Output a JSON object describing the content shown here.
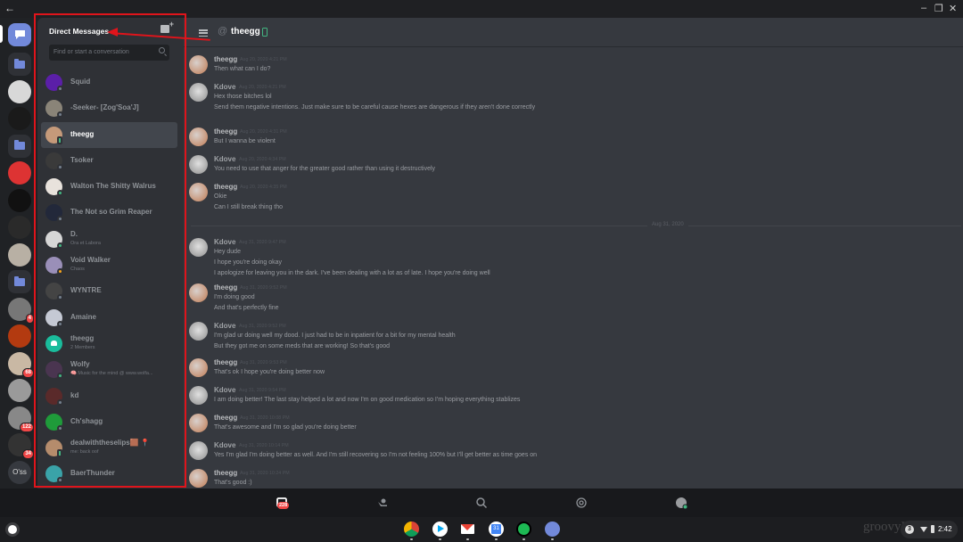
{
  "window": {
    "back_glyph": "←",
    "controls": [
      "–",
      "❐",
      "✕"
    ]
  },
  "rail": {
    "home_icon": "chat-bubble-icon",
    "servers": [
      {
        "kind": "folder"
      },
      {
        "kind": "server",
        "color": "#d8d8d8"
      },
      {
        "kind": "server",
        "color": "#1a1a1a"
      },
      {
        "kind": "folder"
      },
      {
        "kind": "server",
        "color": "#d33"
      },
      {
        "kind": "server",
        "color": "#111"
      },
      {
        "kind": "server",
        "color": "#2a2a2a"
      },
      {
        "kind": "server",
        "color": "#b8b0a4"
      },
      {
        "kind": "folder"
      },
      {
        "kind": "server",
        "color": "#777",
        "badge": "4"
      },
      {
        "kind": "server",
        "color": "#b33a10"
      },
      {
        "kind": "server",
        "color": "#c9b8a4",
        "badge": "68"
      },
      {
        "kind": "server",
        "color": "#9a9a9a"
      },
      {
        "kind": "server",
        "color": "#888",
        "badge": "122"
      },
      {
        "kind": "server",
        "color": "#333",
        "badge": "34"
      },
      {
        "kind": "text",
        "label": "O'ss"
      }
    ]
  },
  "dm": {
    "title": "Direct Messages",
    "search_placeholder": "Find or start a conversation",
    "items": [
      {
        "name": "Squid",
        "sub": "",
        "avatar": "#5b1fa8",
        "status": "offline"
      },
      {
        "name": "-Seeker- [Zog'Soa'J]",
        "sub": "",
        "avatar": "#8a8478",
        "status": "offline"
      },
      {
        "name": "theegg",
        "sub": "",
        "avatar": "#c59a7a",
        "status": "mobile",
        "active": true
      },
      {
        "name": "Tsoker",
        "sub": "",
        "avatar": "#3a3a3a",
        "status": "offline"
      },
      {
        "name": "Walton The Shitty Walrus",
        "sub": "",
        "avatar": "#e8e2dc",
        "status": "online"
      },
      {
        "name": "The Not so Grim Reaper",
        "sub": "",
        "avatar": "#22283a",
        "status": "offline"
      },
      {
        "name": "D.",
        "sub": "Ora et Labora",
        "avatar": "#d6d6d6",
        "status": "online"
      },
      {
        "name": "Void Walker",
        "sub": "Chaos",
        "avatar": "#9a8fb8",
        "status": "idle"
      },
      {
        "name": "WYNTRE",
        "sub": "",
        "avatar": "#444",
        "status": "offline"
      },
      {
        "name": "Amaine",
        "sub": "",
        "avatar": "#c5c9d4",
        "status": "offline"
      },
      {
        "name": "theegg",
        "sub": "2 Members",
        "avatar": "#1abc9c",
        "status": "group"
      },
      {
        "name": "Wolfy",
        "sub": "🧠 Music for the mind @ www.wolfa...",
        "avatar": "#4a3550",
        "status": "online"
      },
      {
        "name": "kd",
        "sub": "",
        "avatar": "#5a2a2a",
        "status": "offline"
      },
      {
        "name": "Ch'shagg",
        "sub": "",
        "avatar": "#1f9b3a",
        "status": "offline"
      },
      {
        "name": "dealwiththeselips🟫 📍",
        "sub": "me: back oof",
        "avatar": "#b58c6c",
        "status": "mobile"
      },
      {
        "name": "BaerThunder",
        "sub": "",
        "avatar": "#3aa3a8",
        "status": "offline"
      }
    ]
  },
  "chat": {
    "channel": "theegg",
    "at_symbol": "@",
    "divider_label": "Aug 31, 2020",
    "messages": [
      {
        "author": "theegg",
        "time": "Aug 20, 2020 4:21 PM",
        "lines": [
          "Then what can I do?"
        ]
      },
      {
        "author": "Kdove",
        "time": "Aug 20, 2020 4:21 PM",
        "lines": [
          "Hex those bitches lol",
          "Send them negative intentions. Just make sure to be careful cause hexes are dangerous if they aren't done correctly"
        ]
      },
      {
        "author": "theegg",
        "time": "Aug 20, 2020 4:31 PM",
        "lines": [
          "But I wanna be violent"
        ]
      },
      {
        "author": "Kdove",
        "time": "Aug 20, 2020 4:34 PM",
        "lines": [
          "You need to use that anger for the greater good rather than using it destructively"
        ]
      },
      {
        "author": "theegg",
        "time": "Aug 20, 2020 4:35 PM",
        "lines": [
          "Okie",
          "Can I still break thing tho"
        ]
      },
      {
        "author": "Kdove",
        "time": "Aug 31, 2020 9:47 PM",
        "lines": [
          "Hey dude",
          "I hope you're doing okay",
          "I apologize for leaving you in the dark. I've been dealing with a lot as of late. I hope you're doing well"
        ]
      },
      {
        "author": "theegg",
        "time": "Aug 31, 2020 9:52 PM",
        "lines": [
          "I'm doing good",
          "And that's perfectly fine"
        ]
      },
      {
        "author": "Kdove",
        "time": "Aug 31, 2020 9:52 PM",
        "lines": [
          "I'm glad ur doing well my dood. I just had to be in inpatient for a bit for my mental health",
          "But they got me on some meds that are working! So that's good"
        ]
      },
      {
        "author": "theegg",
        "time": "Aug 31, 2020 9:53 PM",
        "lines": [
          "That's ok I hope you're doing better now"
        ]
      },
      {
        "author": "Kdove",
        "time": "Aug 31, 2020 9:54 PM",
        "lines": [
          "I am doing better! The last stay helped a lot and now I'm on good medication so I'm hoping everything stablizes"
        ]
      },
      {
        "author": "theegg",
        "time": "Aug 31, 2020 10:08 PM",
        "lines": [
          "That's awesome and I'm so glad you're doing better"
        ]
      },
      {
        "author": "Kdove",
        "time": "Aug 31, 2020 10:14 PM",
        "lines": [
          "Yes I'm glad I'm doing better as well. And I'm still recovering so I'm not feeling 100% but I'll get better as time goes on"
        ]
      },
      {
        "author": "theegg",
        "time": "Aug 31, 2020 10:24 PM",
        "lines": [
          "That's good :)"
        ]
      }
    ]
  },
  "bottom_nav": {
    "items": [
      "home-icon",
      "friends-icon",
      "search-icon",
      "mentions-icon",
      "profile-icon"
    ],
    "home_badge": "228"
  },
  "shelf": {
    "apps": [
      {
        "name": "chrome",
        "color": "#db4437"
      },
      {
        "name": "play-store",
        "color": "#ffffff"
      },
      {
        "name": "gmail",
        "color": "#ea4335"
      },
      {
        "name": "calendar",
        "color": "#4285f4",
        "label": "31"
      },
      {
        "name": "spotify",
        "color": "#1db954"
      },
      {
        "name": "discord",
        "color": "#7289da"
      }
    ],
    "time": "2:42",
    "notification_count": "3",
    "watermark": "groovyPost.com"
  },
  "colors": {
    "accent": "#7289da",
    "online": "#43b581",
    "idle": "#faa61a",
    "badge": "#f04747",
    "annotation": "#e0141b"
  }
}
